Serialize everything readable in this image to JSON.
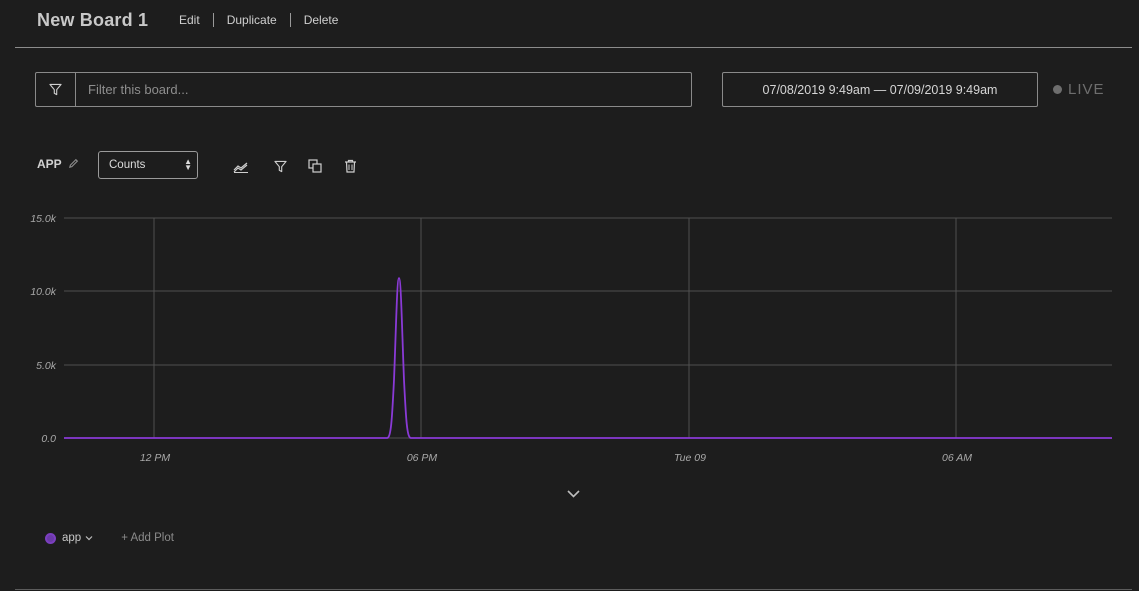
{
  "header": {
    "title": "New Board 1",
    "actions": [
      "Edit",
      "Duplicate",
      "Delete"
    ]
  },
  "filter": {
    "placeholder": "Filter this board...",
    "value": ""
  },
  "date_range": "07/08/2019 9:49am — 07/09/2019 9:49am",
  "live_label": "LIVE",
  "plot": {
    "name": "APP",
    "aggregation": "Counts",
    "tools": [
      "chart-type-icon",
      "filter-icon",
      "duplicate-icon",
      "trash-icon"
    ]
  },
  "chart_data": {
    "type": "line",
    "x_labels": [
      "12 PM",
      "06 PM",
      "Tue 09",
      "06 AM"
    ],
    "y_ticks": [
      "15.0k",
      "10.0k",
      "5.0k",
      "0.0"
    ],
    "ylim": [
      0,
      15000
    ],
    "series": [
      {
        "name": "app",
        "color": "#8a3ad6",
        "description_points": [
          [
            "07/08 9:49am",
            0
          ],
          [
            "07/08 5:30pm",
            0
          ],
          [
            "07/08 5:42pm",
            4000
          ],
          [
            "07/08 5:47pm",
            11000
          ],
          [
            "07/08 5:52pm",
            4000
          ],
          [
            "07/08 6:00pm",
            0
          ],
          [
            "07/09 9:49am",
            0
          ]
        ]
      }
    ],
    "grid": true
  },
  "legend": {
    "series_label": "app",
    "add_plot": "+ Add Plot"
  },
  "colors": {
    "background": "#1d1d1d",
    "series": "#8a3ad6"
  }
}
